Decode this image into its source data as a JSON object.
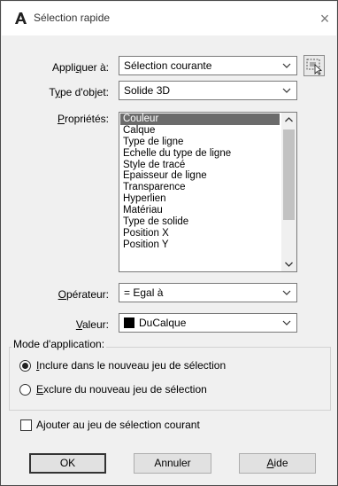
{
  "window": {
    "title": "Sélection rapide",
    "close_symbol": "×",
    "app_icon": "autocad-icon"
  },
  "form": {
    "apply_to": {
      "label_pre": "Appli",
      "label_ul": "q",
      "label_post": "uer à:",
      "value": "Sélection courante"
    },
    "object_type": {
      "label_pre": "T",
      "label_ul": "y",
      "label_post": "pe d'objet:",
      "value": "Solide 3D"
    },
    "properties": {
      "label_pre": "",
      "label_ul": "P",
      "label_post": "ropriétés:",
      "items": [
        "Couleur",
        "Calque",
        "Type de ligne",
        "Echelle du type de ligne",
        "Style de tracé",
        "Epaisseur de ligne",
        "Transparence",
        "Hyperlien",
        "Matériau",
        "Type de solide",
        "Position X",
        "Position Y"
      ],
      "selected_index": 0
    },
    "operator": {
      "label_pre": "",
      "label_ul": "O",
      "label_post": "pérateur:",
      "value": "= Egal à"
    },
    "value": {
      "label_pre": "",
      "label_ul": "V",
      "label_post": "aleur:",
      "value": "DuCalque",
      "swatch_color": "#000000"
    }
  },
  "mode": {
    "legend": "Mode d'application:",
    "include": {
      "pre": "",
      "ul": "I",
      "post": "nclure dans le nouveau jeu de sélection",
      "selected": true
    },
    "exclude": {
      "pre": "",
      "ul": "E",
      "post": "xclure du nouveau jeu de sélection",
      "selected": false
    }
  },
  "append": {
    "pre": "A",
    "ul": "j",
    "post": "outer au jeu de sélection courant",
    "checked": false
  },
  "buttons": {
    "ok": "OK",
    "cancel": "Annuler",
    "help_ul": "A",
    "help_post": "ide"
  }
}
